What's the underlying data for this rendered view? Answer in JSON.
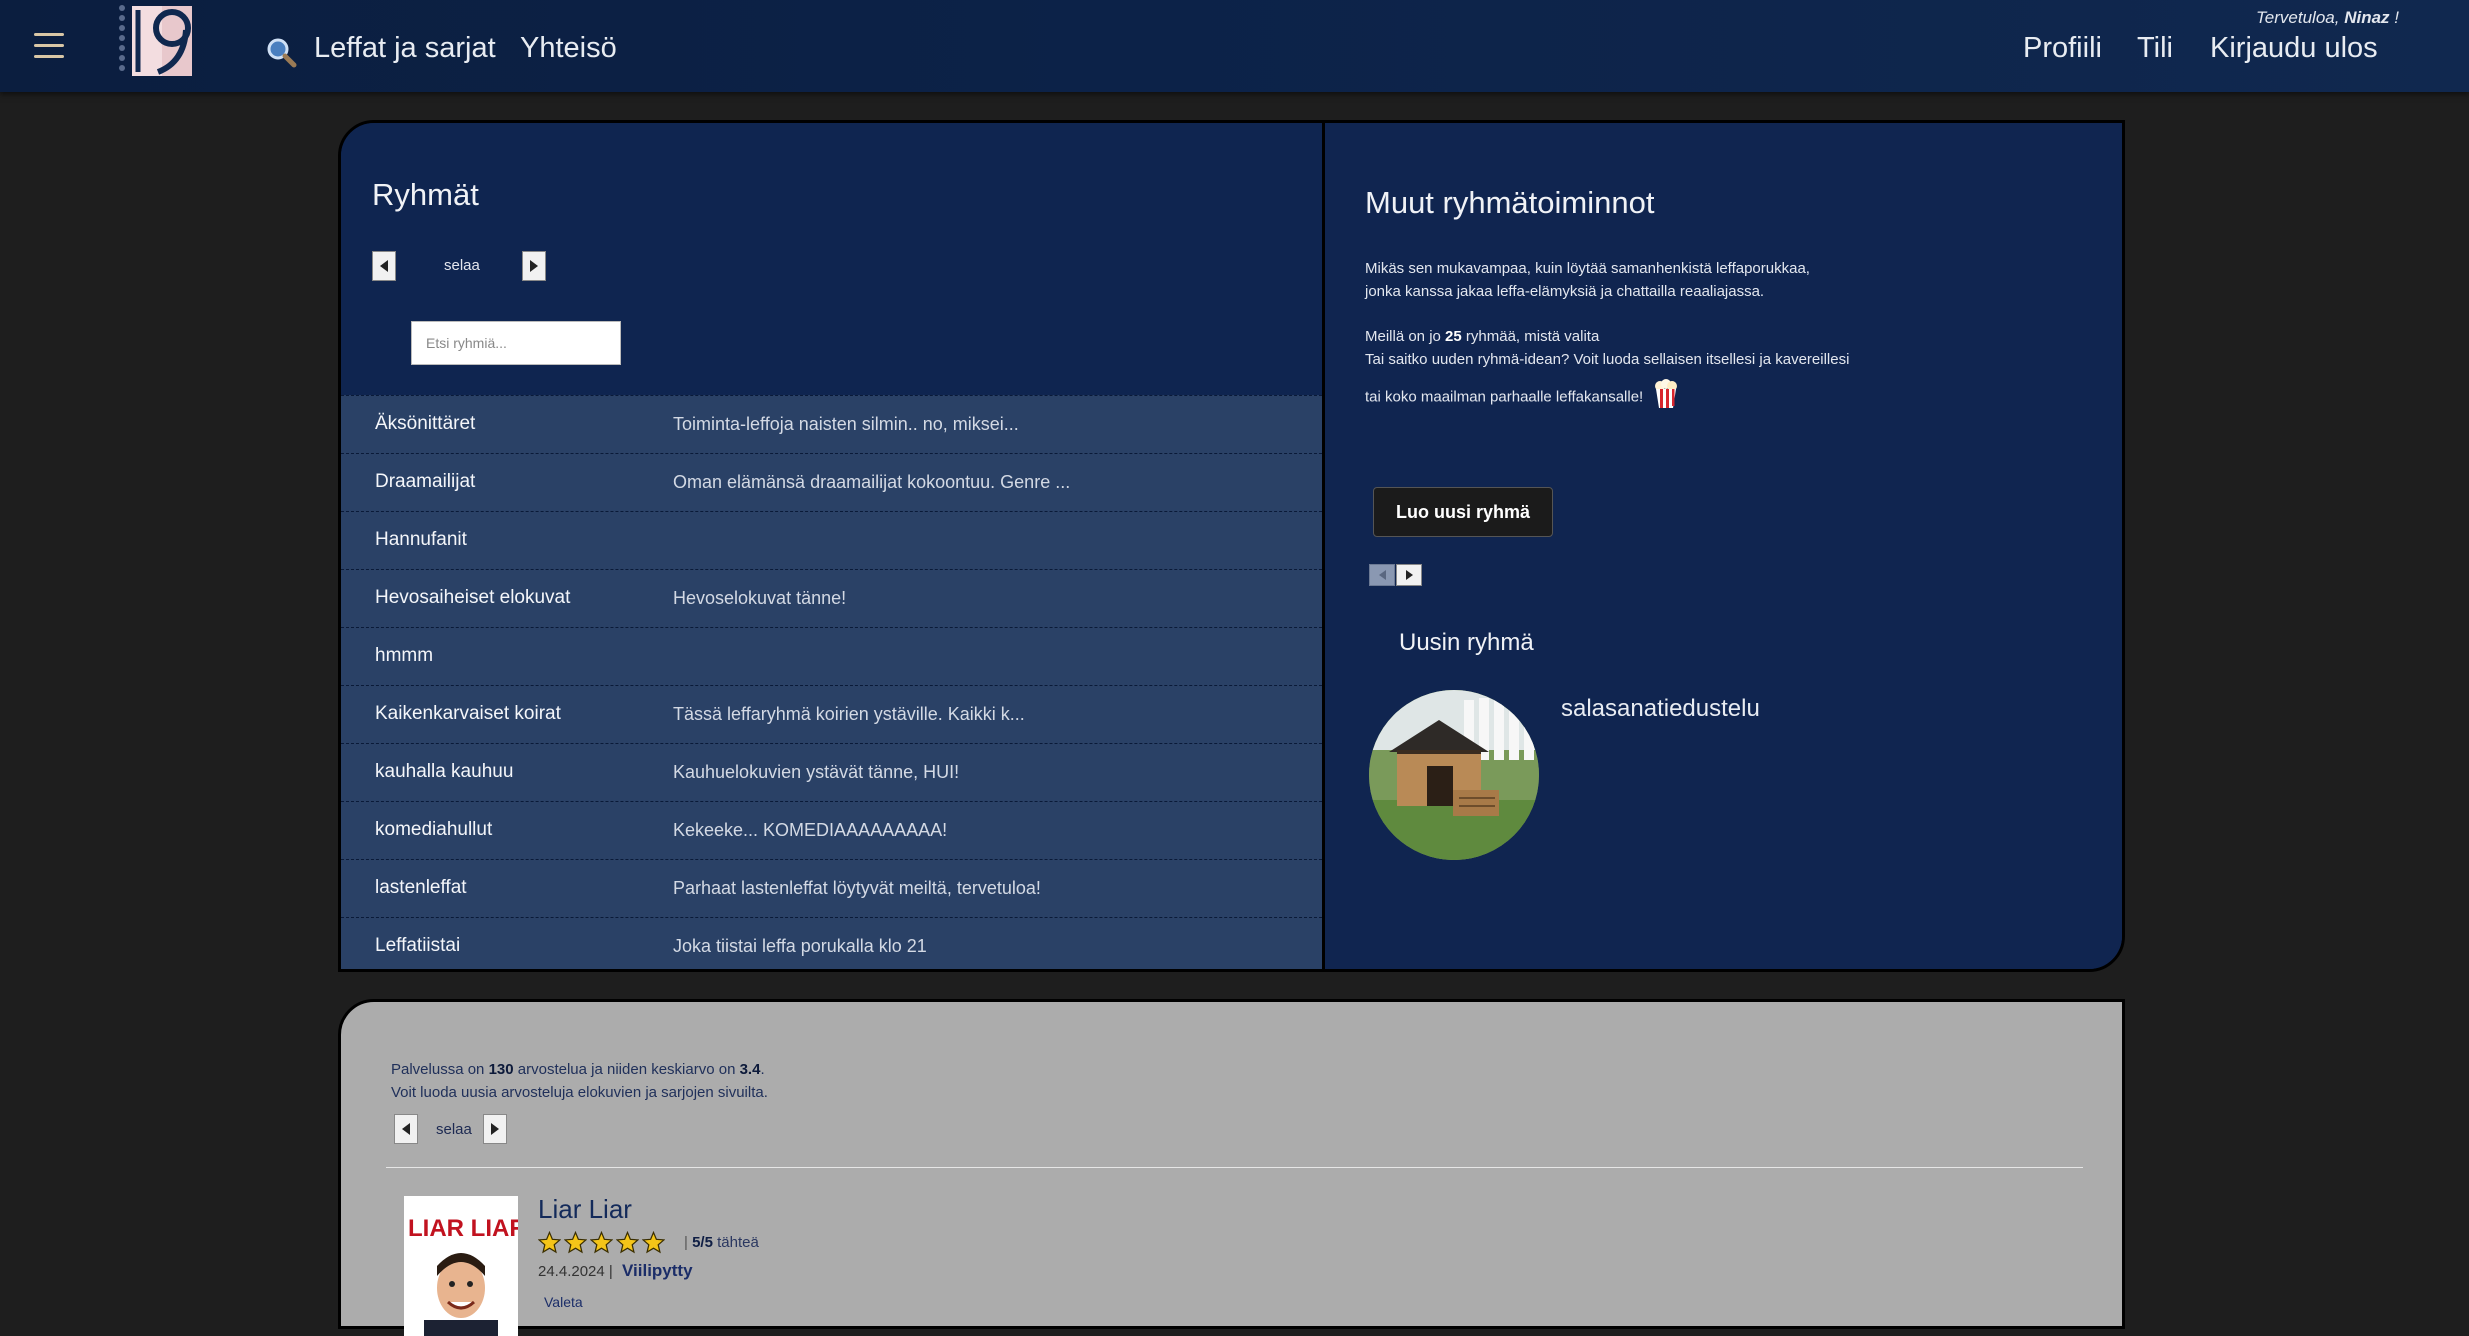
{
  "nav": {
    "movies_label": "Leffat ja sarjat",
    "community_label": "Yhteisö",
    "profile_label": "Profiili",
    "account_label": "Tili",
    "logout_label": "Kirjaudu ulos",
    "welcome_prefix": "Tervetuloa,",
    "username": "Ninaz",
    "welcome_suffix": "!"
  },
  "groups": {
    "title": "Ryhmät",
    "pager_label": "selaa",
    "search_placeholder": "Etsi ryhmiä...",
    "items": [
      {
        "name": "Äksönittäret",
        "desc": "Toiminta-leffoja naisten silmin.. no, miksei..."
      },
      {
        "name": "Draamailijat",
        "desc": "Oman elämänsä draamailijat kokoontuu. Genre ..."
      },
      {
        "name": "Hannufanit",
        "desc": ""
      },
      {
        "name": "Hevosaiheiset elokuvat",
        "desc": "Hevoselokuvat tänne!"
      },
      {
        "name": "hmmm",
        "desc": ""
      },
      {
        "name": "Kaikenkarvaiset koirat",
        "desc": "Tässä leffaryhmä koirien ystäville. Kaikki k..."
      },
      {
        "name": "kauhalla kauhuu",
        "desc": "Kauhuelokuvien ystävät tänne, HUI!"
      },
      {
        "name": "komediahullut",
        "desc": "Kekeeke... KOMEDIAAAAAAAAA!"
      },
      {
        "name": "lastenleffat",
        "desc": "Parhaat lastenleffat löytyvät meiltä, tervetuloa!"
      },
      {
        "name": "Leffatiistai",
        "desc": "Joka tiistai leffa porukalla klo 21"
      }
    ]
  },
  "actions": {
    "title": "Muut ryhmätoiminnot",
    "line1": "Mikäs sen mukavampaa, kuin löytää samanhenkistä leffaporukkaa,",
    "line2": "jonka kanssa jakaa leffa-elämyksiä ja chattailla reaaliajassa.",
    "count_prefix": "Meillä on jo",
    "group_count": "25",
    "count_suffix": "ryhmää, mistä valita",
    "line4": "Tai saitko uuden ryhmä-idean? Voit luoda sellaisen itsellesi ja kavereillesi",
    "line5": "tai koko maailman parhaalle leffakansalle!",
    "popcorn_icon": "popcorn-icon",
    "create_button": "Luo uusi ryhmä",
    "newest_title": "Uusin ryhmä",
    "newest_name": "salasanatiedustelu"
  },
  "reviews": {
    "stats_prefix": "Palvelussa on",
    "review_count": "130",
    "stats_middle": "arvostelua ja niiden keskiarvo on",
    "average": "3.4",
    "stats_suffix": ".",
    "line2": "Voit luoda uusia arvosteluja elokuvien ja sarjojen sivuilta.",
    "pager_label": "selaa",
    "item": {
      "title": "Liar Liar",
      "poster_text": "LIAR LIAR",
      "rating": 5,
      "rating_text": "5/5",
      "rating_unit": "tähteä",
      "date": "24.4.2024 |",
      "user": "Viilipytty",
      "tag": "Valeta"
    }
  },
  "colors": {
    "nav_bg": "#0c2248",
    "panel_bg": "#0f2550",
    "row_bg": "#2a4166",
    "reviews_bg": "#acacac",
    "star": "#f5c518"
  }
}
